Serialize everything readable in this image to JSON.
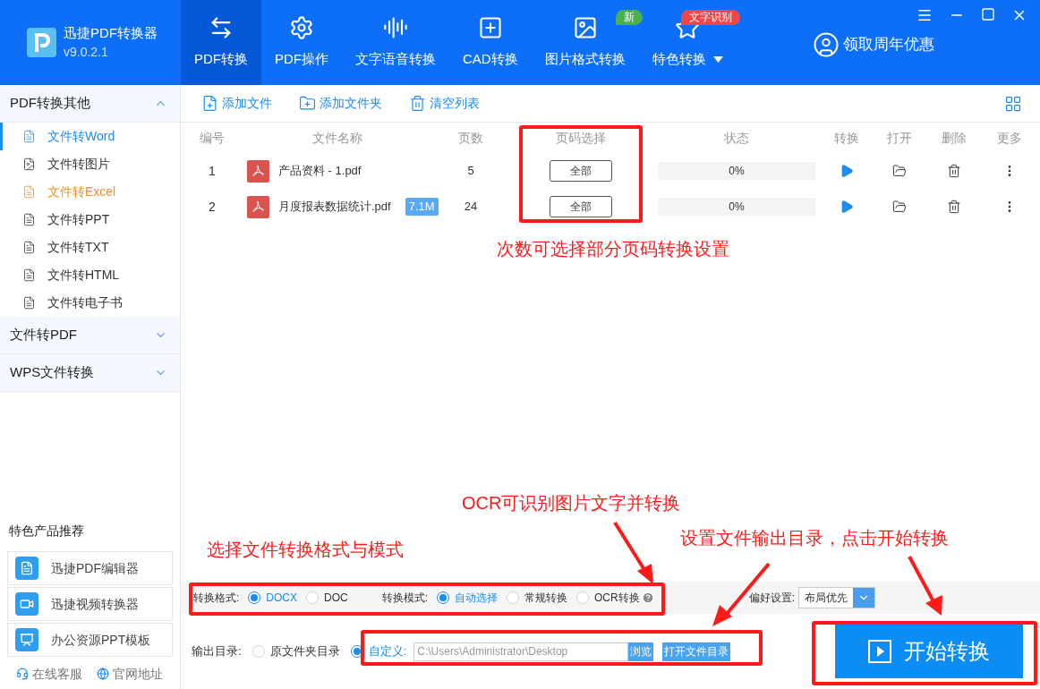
{
  "app": {
    "name": "迅捷PDF转换器",
    "version": "v9.0.2.1"
  },
  "nav_tabs": [
    {
      "label": "PDF转换",
      "selected": true
    },
    {
      "label": "PDF操作",
      "selected": false
    },
    {
      "label": "文字语音转换",
      "selected": false
    },
    {
      "label": "CAD转换",
      "selected": false
    },
    {
      "label": "图片格式转换",
      "selected": false,
      "badge": "新",
      "color": "#4caf50"
    },
    {
      "label": "特色转换",
      "selected": false,
      "badge": "文字识别",
      "color": "#f04848",
      "dropdown": true
    }
  ],
  "promo": "领取周年优惠",
  "sidebar": {
    "groups": [
      {
        "label": "PDF转换其他",
        "expanded": true,
        "children": [
          {
            "label": "文件转Word",
            "selected": true,
            "highlighted": false
          },
          {
            "label": "文件转图片",
            "selected": false,
            "highlighted": false
          },
          {
            "label": "文件转Excel",
            "selected": false,
            "highlighted": true
          },
          {
            "label": "文件转PPT",
            "selected": false,
            "highlighted": false
          },
          {
            "label": "文件转TXT",
            "selected": false,
            "highlighted": false
          },
          {
            "label": "文件转HTML",
            "selected": false,
            "highlighted": false
          },
          {
            "label": "文件转电子书",
            "selected": false,
            "highlighted": false
          }
        ]
      },
      {
        "label": "文件转PDF",
        "expanded": false
      },
      {
        "label": "WPS文件转换",
        "expanded": false
      }
    ],
    "products_title": "特色产品推荐",
    "products": [
      "迅捷PDF编辑器",
      "迅捷视频转换器",
      "办公资源PPT模板"
    ],
    "footer_links": [
      "在线客服",
      "官网地址"
    ]
  },
  "toolbar": [
    "添加文件",
    "添加文件夹",
    "清空列表"
  ],
  "table": {
    "columns": [
      "编号",
      "文件名称",
      "页数",
      "页码选择",
      "状态",
      "转换",
      "打开",
      "删除",
      "更多"
    ],
    "rows": [
      {
        "index": "1",
        "name": "产品资料 - 1.pdf",
        "pages": "5",
        "page_range": "全部",
        "status": "0%",
        "level": 0
      },
      {
        "index": "2",
        "name": "月度报表数据统计.pdf",
        "size": "7.1M",
        "pages": "24",
        "page_range": "全部",
        "status": "0%",
        "level": 0
      }
    ]
  },
  "settings": {
    "format_label": "转换格式:",
    "formats": [
      {
        "label": "DOCX",
        "selected": true
      },
      {
        "label": "DOC",
        "selected": false
      }
    ],
    "mode_label": "转换模式:",
    "modes": [
      {
        "label": "自动选择",
        "selected": true
      },
      {
        "label": "常规转换",
        "selected": false
      },
      {
        "label": "OCR转换",
        "selected": false
      }
    ],
    "pref_label": "偏好设置:",
    "pref_value": "布局优先"
  },
  "output": {
    "label": "输出目录:",
    "options": [
      {
        "label": "原文件夹目录",
        "selected": false
      },
      {
        "label": "自定义:",
        "selected": true
      }
    ],
    "path": "C:\\Users\\Administrator\\Desktop",
    "browse": "浏览",
    "open_folder": "打开文件目录"
  },
  "start_button": "开始转换",
  "annotations": [
    "次数可选择部分页码转换设置",
    "OCR可识别图片文字并转换",
    "选择文件转换格式与模式",
    "设置文件输出目录，点击开始转换"
  ]
}
